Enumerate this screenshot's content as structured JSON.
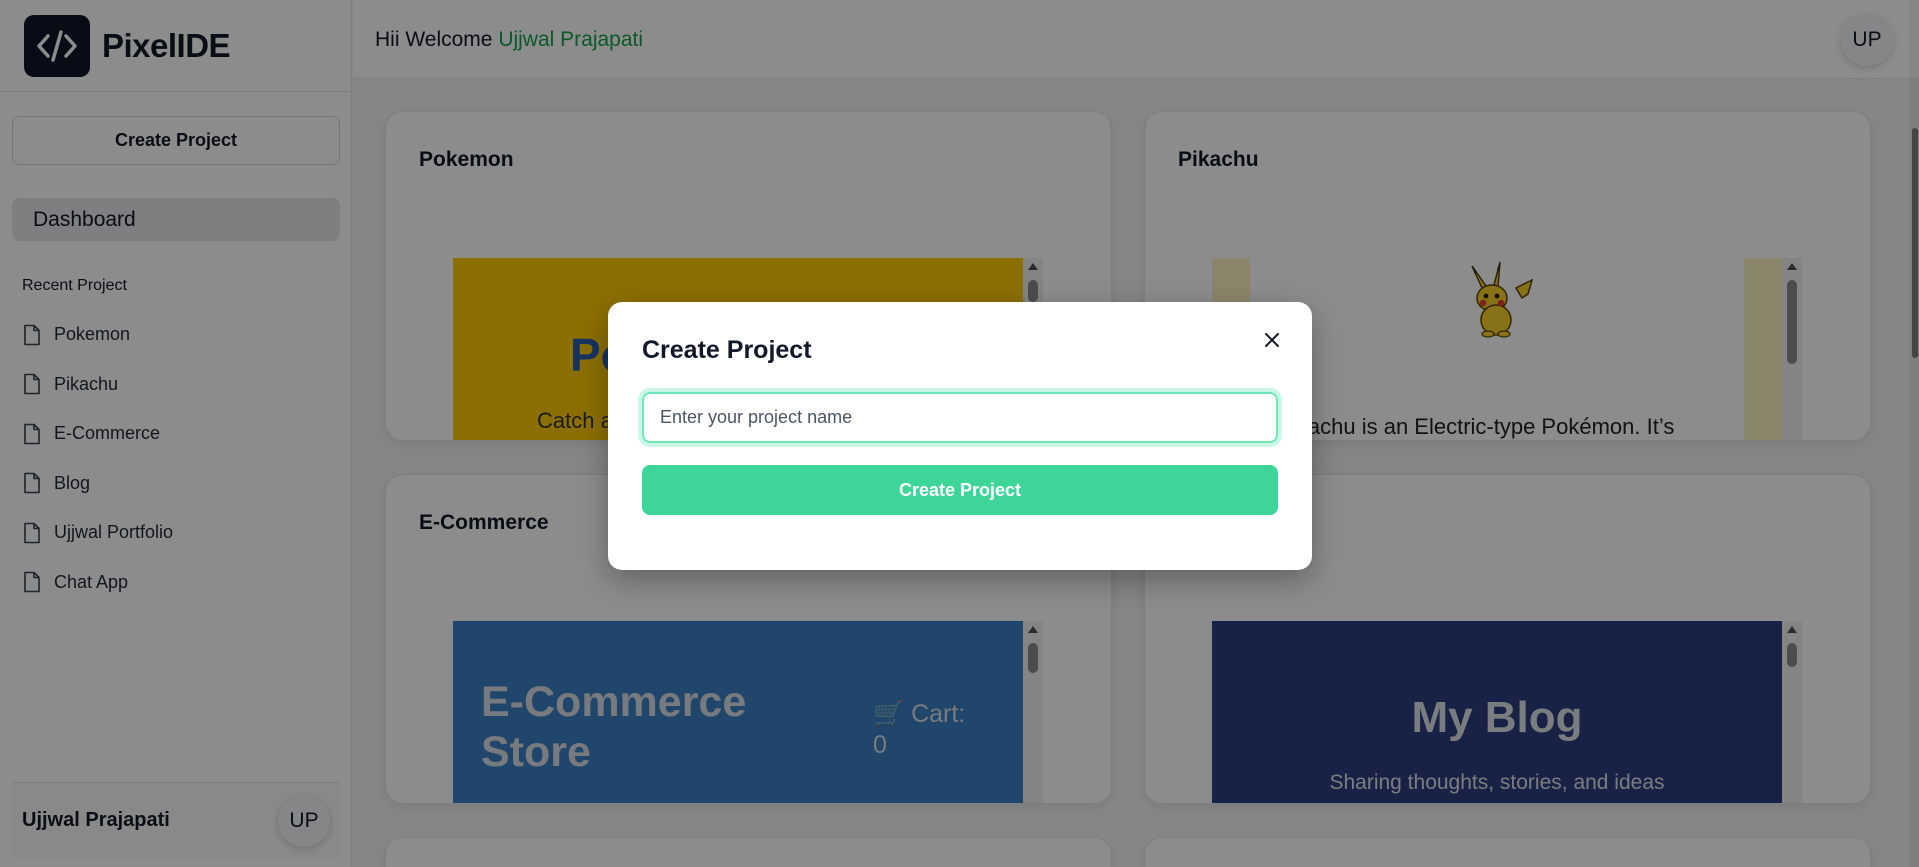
{
  "app": {
    "brand": "PixelIDE"
  },
  "sidebar": {
    "create_label": "Create Project",
    "dashboard_label": "Dashboard",
    "recent_title": "Recent Project",
    "recent_items": [
      "Pokemon",
      "Pikachu",
      "E-Commerce",
      "Blog",
      "Ujjwal Portfolio",
      "Chat App"
    ],
    "footer_name": "Ujjwal Prajapati",
    "footer_initials": "UP"
  },
  "header": {
    "greeting": "Hii Welcome ",
    "user_name": "Ujjwal Prajapati",
    "initials": "UP"
  },
  "cards": [
    {
      "title": "Pokemon",
      "preview_heading": "Po",
      "preview_text": "Catch a"
    },
    {
      "title": "Pikachu",
      "preview_text": "ikachu is an Electric-type Pokémon. It’s"
    },
    {
      "title": "E-Commerce",
      "preview_heading": "E-Commerce Store",
      "preview_cart": "🛒 Cart: 0"
    },
    {
      "title": "",
      "preview_heading": "My Blog",
      "preview_text": "Sharing thoughts, stories, and ideas"
    }
  ],
  "modal": {
    "title": "Create Project",
    "input_placeholder": "Enter your project name",
    "input_value": "",
    "submit_label": "Create Project"
  },
  "colors": {
    "accent": "#3dd598",
    "username": "#16a34a",
    "pokemon_bg": "#ffcb05",
    "ecommerce_bg": "#3b82c4",
    "blog_bg": "#2c3e80"
  }
}
